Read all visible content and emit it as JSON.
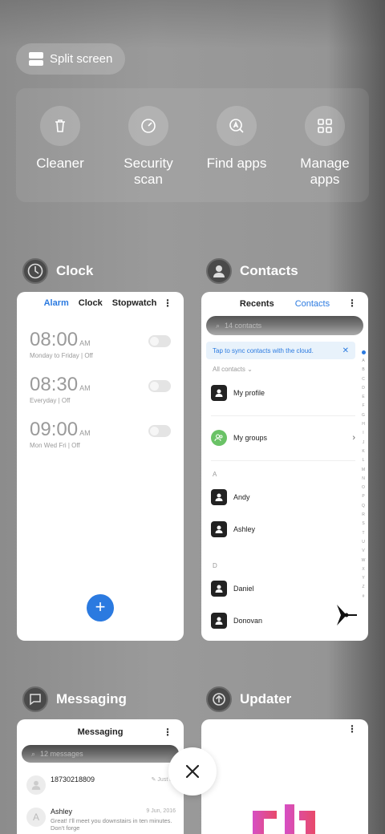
{
  "split_screen": {
    "label": "Split screen"
  },
  "tools": [
    {
      "label": "Cleaner",
      "icon": "trash-icon"
    },
    {
      "label": "Security\nscan",
      "icon": "speedometer-icon"
    },
    {
      "label": "Find apps",
      "icon": "search-apps-icon"
    },
    {
      "label": "Manage\napps",
      "icon": "grid-icon"
    }
  ],
  "apps": {
    "clock": {
      "name": "Clock",
      "tabs": [
        "Alarm",
        "Clock",
        "Stopwatch"
      ],
      "alarms": [
        {
          "time": "08:00",
          "ampm": "AM",
          "days": "Monday to Friday | Off"
        },
        {
          "time": "08:30",
          "ampm": "AM",
          "days": "Everyday | Off"
        },
        {
          "time": "09:00",
          "ampm": "AM",
          "days": "Mon Wed Fri | Off"
        }
      ],
      "fab": "+"
    },
    "contacts": {
      "name": "Contacts",
      "tabs": [
        "Recents",
        "Contacts"
      ],
      "search_placeholder": "14 contacts",
      "sync_banner": "Tap to sync contacts with the cloud.",
      "filter": "All contacts",
      "my_profile": "My profile",
      "my_groups": "My groups",
      "sections": [
        {
          "letter": "A",
          "names": [
            "Andy",
            "Ashley"
          ]
        },
        {
          "letter": "D",
          "names": [
            "Daniel",
            "Donovan"
          ]
        }
      ],
      "alphabet": [
        "A",
        "B",
        "C",
        "D",
        "E",
        "F",
        "G",
        "H",
        "I",
        "J",
        "K",
        "L",
        "M",
        "N",
        "O",
        "P",
        "Q",
        "R",
        "S",
        "T",
        "U",
        "V",
        "W",
        "X",
        "Y",
        "Z",
        "#"
      ]
    },
    "messaging": {
      "name": "Messaging",
      "title": "Messaging",
      "search_placeholder": "12 messages",
      "messages": [
        {
          "avatar": "",
          "name": "18730218809",
          "time": "Just no",
          "text": ""
        },
        {
          "avatar": "A",
          "name": "Ashley",
          "time": "9 Jun, 2016",
          "text": "Great! I'll meet you downstairs in ten minutes. Don't forge"
        }
      ]
    },
    "updater": {
      "name": "Updater"
    }
  },
  "colors": {
    "accent": "#2b7ae0",
    "green": "#6ac266",
    "overlay": "#959595"
  }
}
